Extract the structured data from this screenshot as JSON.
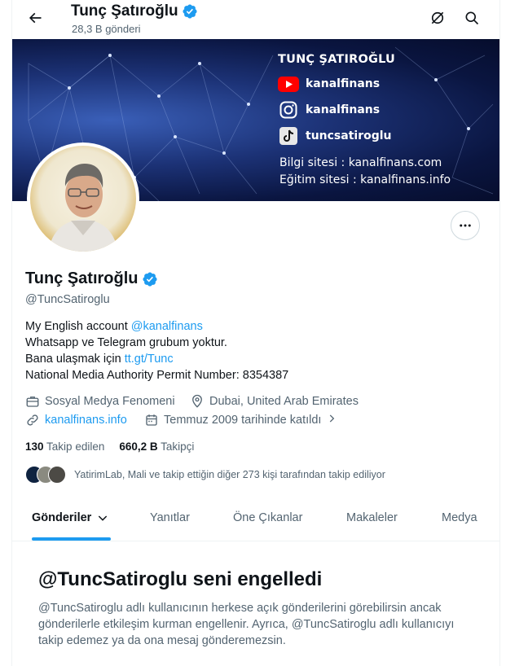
{
  "header": {
    "name": "Tunç Şatıroğlu",
    "post_count": "28,3 B gönderi",
    "back_icon": "arrow-left-icon",
    "grok_icon": "grok-icon",
    "search_icon": "search-icon"
  },
  "banner": {
    "title": "TUNÇ ŞATIROĞLU",
    "youtube": "kanalfinans",
    "instagram": "kanalfinans",
    "tiktok": "tuncsatiroglu",
    "info_site": "Bilgi sitesi : kanalfinans.com",
    "edu_site": "Eğitim sitesi : kanalfinans.info"
  },
  "profile": {
    "name": "Tunç Şatıroğlu",
    "handle": "@TuncSatiroglu",
    "bio": {
      "line1_text": "My English account ",
      "line1_link": "@kanalfinans",
      "line2": "Whatsapp ve Telegram grubum yoktur.",
      "line3_text": "Bana ulaşmak için ",
      "line3_link": "tt.gt/Tunc",
      "line4": "National Media Authority Permit Number: 8354387"
    },
    "category": "Sosyal Medya Fenomeni",
    "location": "Dubai, United Arab Emirates",
    "website": "kanalfinans.info",
    "joined": "Temmuz 2009 tarihinde katıldı",
    "following_count": "130",
    "following_label": "Takip edilen",
    "followers_count": "660,2 B",
    "followers_label": "Takipçi",
    "followed_by": "YatirimLab, Mali ve takip ettiğin diğer 273 kişi tarafından takip ediliyor"
  },
  "tabs": [
    {
      "label": "Gönderiler",
      "active": true
    },
    {
      "label": "Yanıtlar"
    },
    {
      "label": "Öne Çıkanlar"
    },
    {
      "label": "Makaleler"
    },
    {
      "label": "Medya"
    }
  ],
  "blocked": {
    "title": "@TuncSatiroglu seni engelledi",
    "text": "@TuncSatiroglu adlı kullanıcının herkese açık gönderilerini görebilirsin ancak gönderilerle etkileşim kurman engellenir. Ayrıca, @TuncSatiroglu adlı kullanıcıyı takip edemez ya da ona mesaj gönderemezsin."
  },
  "colors": {
    "accent": "#1d9bf0",
    "text": "#0f1419",
    "secondary": "#536471"
  }
}
